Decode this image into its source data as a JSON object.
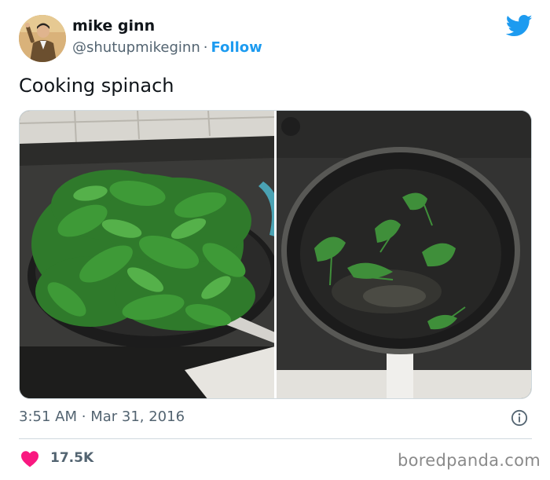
{
  "tweet": {
    "author_name": "mike ginn",
    "author_handle": "@shutupmikeginn",
    "separator": "·",
    "follow_label": "Follow",
    "text": "Cooking spinach",
    "time": "3:51 AM",
    "date": "Mar 31, 2016",
    "likes": "17.5K"
  },
  "media": {
    "images": [
      {
        "subject": "frying pan heaped with raw spinach"
      },
      {
        "subject": "frying pan with a few wilted spinach leaves"
      }
    ]
  },
  "watermark": {
    "text": "boredpanda.com"
  },
  "colors": {
    "accent": "#1d9bf0",
    "text": "#0f1419",
    "secondary": "#536471",
    "like": "#f91880",
    "border": "#cfd9de"
  },
  "icons": {
    "brand": "twitter-bird-icon",
    "info": "info-icon",
    "like": "heart-icon"
  }
}
